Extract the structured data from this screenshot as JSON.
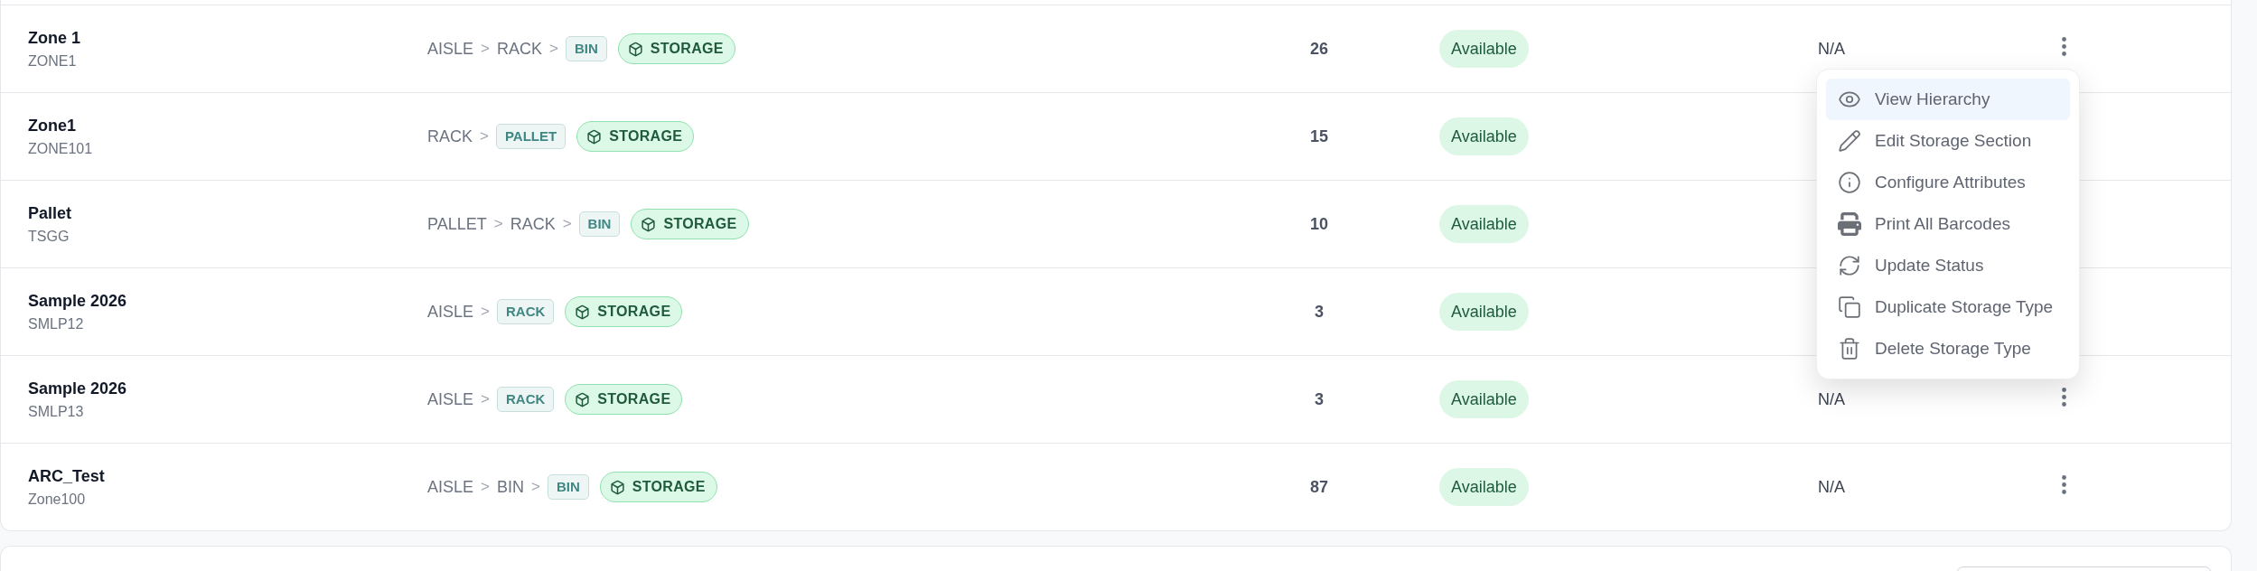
{
  "rows": [
    {
      "column_1": {
        "title": "Zone 1",
        "subtitle": "ZONE1"
      },
      "column_2": {
        "path": [
          {
            "kind": "text",
            "label": "AISLE"
          },
          {
            "kind": "separator",
            "label": ">"
          },
          {
            "kind": "text",
            "label": "RACK"
          },
          {
            "kind": "separator",
            "label": ">"
          },
          {
            "kind": "chip",
            "label": "BIN"
          }
        ],
        "tag": "STORAGE"
      },
      "column_3": "26",
      "column_4": "Available",
      "column_5": "N/A",
      "menu_button": true,
      "menu": {
        "items": [
          {
            "label": "View Hierarchy",
            "selected": true
          },
          {
            "label": "Edit Storage Section",
            "selected": false
          },
          {
            "label": "Configure Attributes",
            "selected": false
          },
          {
            "label": "Print All Barcodes",
            "selected": false
          },
          {
            "label": "Update Status",
            "selected": false
          },
          {
            "label": "Duplicate Storage Type",
            "selected": false
          },
          {
            "label": "Delete Storage Type",
            "selected": false
          }
        ]
      }
    },
    {
      "column_1": {
        "title": "Zone1",
        "subtitle": "ZONE101"
      },
      "column_2": {
        "path": [
          {
            "kind": "text",
            "label": "RACK"
          },
          {
            "kind": "separator",
            "label": ">"
          },
          {
            "kind": "chip",
            "label": "PALLET"
          }
        ],
        "tag": "STORAGE"
      },
      "column_3": "15",
      "column_4": "Available"
    },
    {
      "column_1": {
        "title": "Pallet",
        "subtitle": "TSGG"
      },
      "column_2": {
        "path": [
          {
            "kind": "text",
            "label": "PALLET"
          },
          {
            "kind": "separator",
            "label": ">"
          },
          {
            "kind": "text",
            "label": "RACK"
          },
          {
            "kind": "separator",
            "label": ">"
          },
          {
            "kind": "chip",
            "label": "BIN"
          }
        ],
        "tag": "STORAGE"
      },
      "column_3": "10",
      "column_4": "Available"
    },
    {
      "column_1": {
        "title": "Sample 2026",
        "subtitle": "SMLP12"
      },
      "column_2": {
        "path": [
          {
            "kind": "text",
            "label": "AISLE"
          },
          {
            "kind": "separator",
            "label": ">"
          },
          {
            "kind": "chip",
            "label": "RACK"
          }
        ],
        "tag": "STORAGE"
      },
      "column_3": "3",
      "column_4": "Available"
    },
    {
      "column_1": {
        "title": "Sample 2026",
        "subtitle": "SMLP13"
      },
      "column_2": {
        "path": [
          {
            "kind": "text",
            "label": "AISLE"
          },
          {
            "kind": "separator",
            "label": ">"
          },
          {
            "kind": "chip",
            "label": "RACK"
          }
        ],
        "tag": "STORAGE"
      },
      "column_3": "3",
      "column_4": "Available",
      "column_5": "N/A",
      "menu_button": true
    },
    {
      "column_1": {
        "title": "ARC_Test",
        "subtitle": "Zone100"
      },
      "column_2": {
        "path": [
          {
            "kind": "text",
            "label": "AISLE"
          },
          {
            "kind": "separator",
            "label": ">"
          },
          {
            "kind": "text",
            "label": "BIN"
          },
          {
            "kind": "separator",
            "label": ">"
          },
          {
            "kind": "chip",
            "label": "BIN"
          }
        ],
        "tag": "STORAGE"
      },
      "column_3": "87",
      "column_4": "Available",
      "column_5": "N/A",
      "menu_button": true
    }
  ]
}
